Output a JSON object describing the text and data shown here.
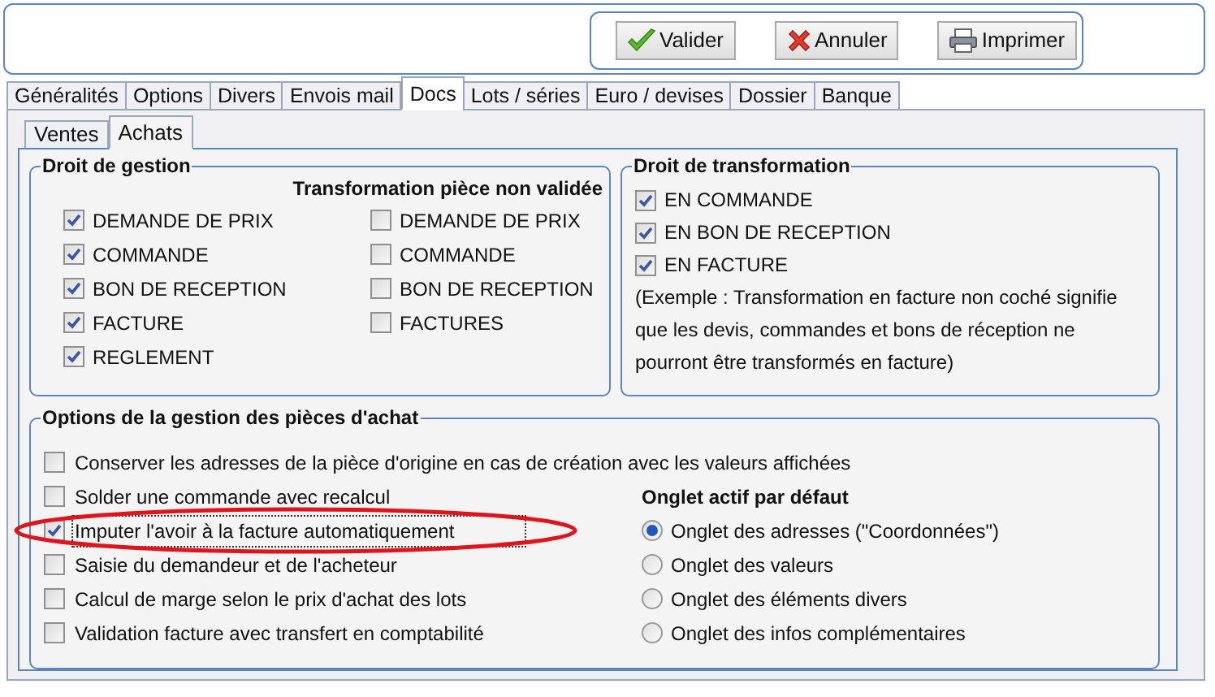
{
  "toolbar": {
    "buttons": [
      {
        "kind": "validate",
        "label": "Valider"
      },
      {
        "kind": "cancel",
        "label": "Annuler"
      },
      {
        "kind": "print",
        "label": "Imprimer"
      }
    ]
  },
  "tabs": [
    {
      "label": "Généralités",
      "selected": false
    },
    {
      "label": "Options",
      "selected": false
    },
    {
      "label": "Divers",
      "selected": false
    },
    {
      "label": "Envois mail",
      "selected": false
    },
    {
      "label": "Docs",
      "selected": true
    },
    {
      "label": "Lots / séries",
      "selected": false
    },
    {
      "label": "Euro / devises",
      "selected": false
    },
    {
      "label": "Dossier",
      "selected": false
    },
    {
      "label": "Banque",
      "selected": false
    }
  ],
  "subtabs": [
    {
      "label": "Ventes",
      "selected": false
    },
    {
      "label": "Achats",
      "selected": true
    }
  ],
  "droit_de_gestion": {
    "title": "Droit de gestion",
    "items": [
      {
        "label": "DEMANDE DE PRIX",
        "checked": true
      },
      {
        "label": "COMMANDE",
        "checked": true
      },
      {
        "label": "BON DE RECEPTION",
        "checked": true
      },
      {
        "label": "FACTURE",
        "checked": true
      },
      {
        "label": "REGLEMENT",
        "checked": true
      }
    ],
    "transformation_title": "Transformation pièce non validée",
    "transformation_items": [
      {
        "label": "DEMANDE DE PRIX",
        "checked": false
      },
      {
        "label": "COMMANDE",
        "checked": false
      },
      {
        "label": "BON DE RECEPTION",
        "checked": false
      },
      {
        "label": "FACTURES",
        "checked": false
      }
    ]
  },
  "droit_de_transformation": {
    "title": "Droit de transformation",
    "items": [
      {
        "label": "EN COMMANDE",
        "checked": true
      },
      {
        "label": "EN BON DE RECEPTION",
        "checked": true
      },
      {
        "label": "EN FACTURE",
        "checked": true
      }
    ],
    "note": "(Exemple : Transformation en facture non coché signifie que les devis, commandes et bons de réception ne pourront être transformés en facture)"
  },
  "options": {
    "title": "Options de la gestion des pièces d'achat",
    "first": {
      "label": "Conserver les adresses de la pièce d'origine en cas de création avec les valeurs affichées",
      "checked": false
    },
    "items": [
      {
        "label": "Solder une commande avec recalcul",
        "checked": false,
        "focused": false,
        "circled": false
      },
      {
        "label": "Imputer l'avoir à la facture automatiquement",
        "checked": true,
        "focused": true,
        "circled": true
      },
      {
        "label": "Saisie du demandeur et de l'acheteur",
        "checked": false,
        "focused": false,
        "circled": false
      },
      {
        "label": "Calcul de marge selon le prix d'achat des lots",
        "checked": false,
        "focused": false,
        "circled": false
      },
      {
        "label": "Validation facture avec transfert en comptabilité",
        "checked": false,
        "focused": false,
        "circled": false
      }
    ],
    "default_tab_title": "Onglet actif par défaut",
    "default_tab": [
      {
        "label": "Onglet des adresses (\"Coordonnées\")",
        "selected": true
      },
      {
        "label": "Onglet des valeurs",
        "selected": false
      },
      {
        "label": "Onglet des éléments divers",
        "selected": false
      },
      {
        "label": "Onglet des infos complémentaires",
        "selected": false
      }
    ]
  }
}
